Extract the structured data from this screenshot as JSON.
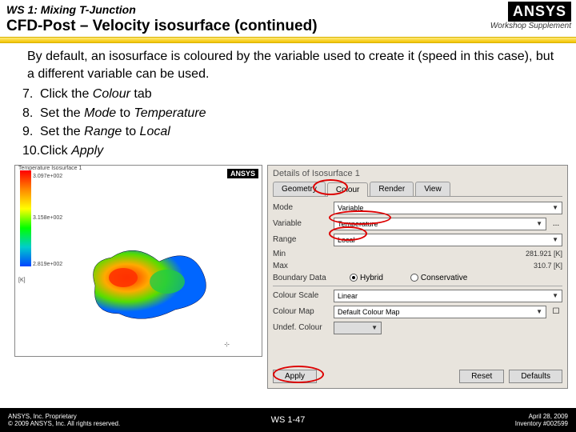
{
  "header": {
    "ws": "WS 1: Mixing T-Junction",
    "title": "CFD-Post – Velocity isosurface (continued)",
    "logo": "ANSYS",
    "logo_sub": "Workshop Supplement"
  },
  "intro": "By default, an isosurface is coloured by the variable used to create it (speed in this case), but a different variable can be used.",
  "steps": [
    {
      "n": "7.",
      "pre": "Click the ",
      "em": "Colour",
      "post": " tab"
    },
    {
      "n": "8.",
      "pre": "Set the ",
      "em": "Mode",
      "post_em": "Temperature",
      "mid": " to "
    },
    {
      "n": "9.",
      "pre": "Set the ",
      "em": "Range",
      "post_em": "Local",
      "mid": " to "
    },
    {
      "n": "10.",
      "pre": "Click ",
      "em": "Apply",
      "post": ""
    }
  ],
  "viz": {
    "ansys": "ANSYS",
    "legend_title": "Temperature\nIsosurface 1",
    "t1": "3.097e+002",
    "t2": "3.158e+002",
    "t3": "2.819e+002",
    "unit": "[K]"
  },
  "panel": {
    "title": "Details of Isosurface 1",
    "tabs": [
      "Geometry",
      "Colour",
      "Render",
      "View"
    ],
    "mode_lbl": "Mode",
    "mode_val": "Variable",
    "var_lbl": "Variable",
    "var_val": "Temperature",
    "range_lbl": "Range",
    "range_val": "Local",
    "min_lbl": "Min",
    "min_val": "281.921 [K]",
    "max_lbl": "Max",
    "max_val": "310.7 [K]",
    "bd_lbl": "Boundary Data",
    "bd_opt1": "Hybrid",
    "bd_opt2": "Conservative",
    "cs_lbl": "Colour Scale",
    "cs_val": "Linear",
    "cm_lbl": "Colour Map",
    "cm_val": "Default Colour Map",
    "uc_lbl": "Undef. Colour",
    "apply": "Apply",
    "reset": "Reset",
    "defaults": "Defaults"
  },
  "footer": {
    "left1": "ANSYS, Inc. Proprietary",
    "left2": "© 2009 ANSYS, Inc. All rights reserved.",
    "center": "WS 1-47",
    "right1": "April 28, 2009",
    "right2": "Inventory #002599"
  }
}
